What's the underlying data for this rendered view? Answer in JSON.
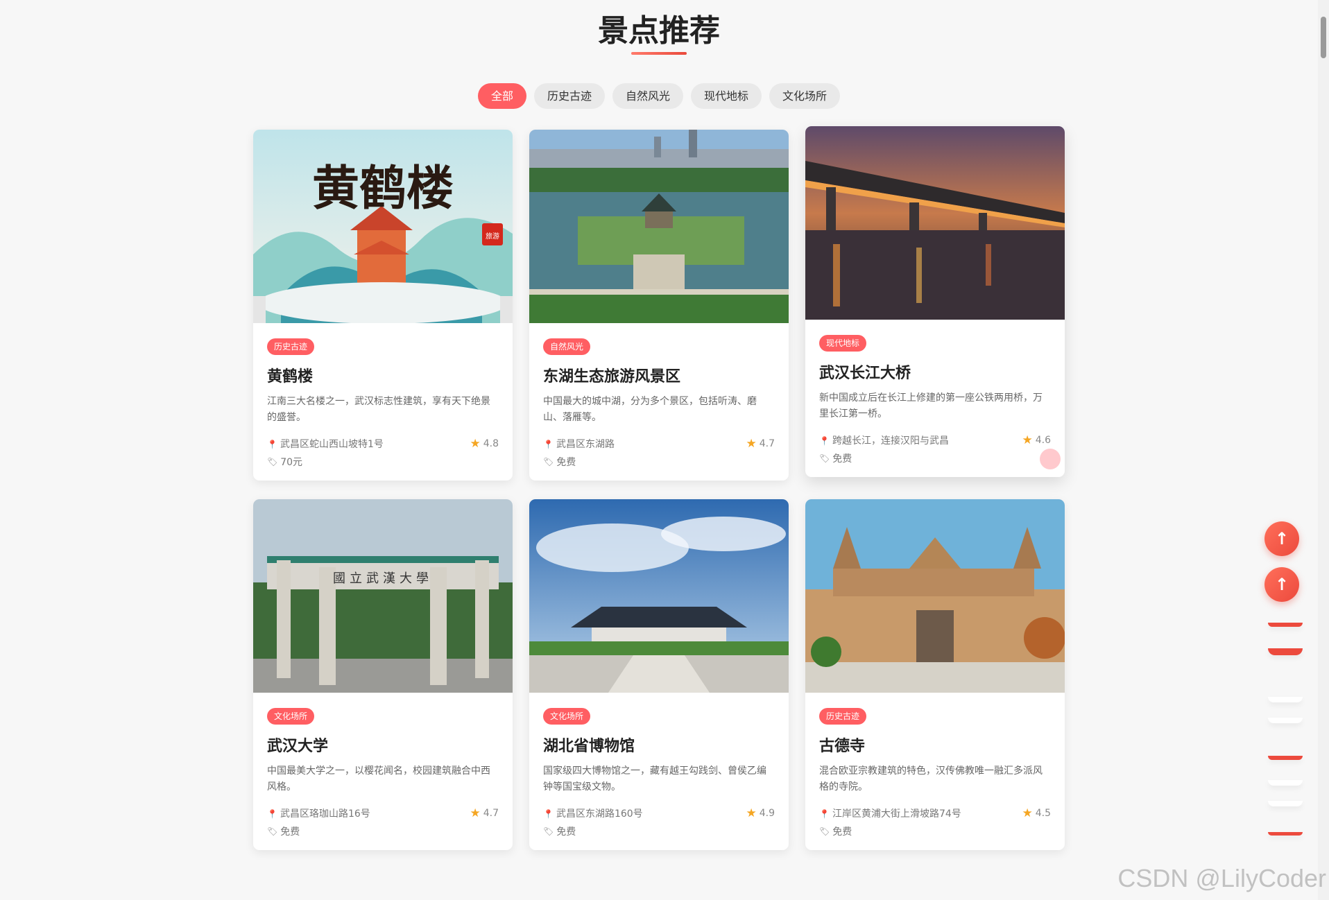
{
  "section_title": "景点推荐",
  "filters": [
    "全部",
    "历史古迹",
    "自然风光",
    "现代地标",
    "文化场所"
  ],
  "active_filter": "全部",
  "cards": [
    {
      "tag": "历史古迹",
      "name": "黄鹤楼",
      "desc": "江南三大名楼之一，武汉标志性建筑，享有天下绝景的盛誉。",
      "address": "武昌区蛇山西山坡特1号",
      "rating": "4.8",
      "price": "70元",
      "image_text": "黄鹤楼",
      "image_stamp": "旅游"
    },
    {
      "tag": "自然风光",
      "name": "东湖生态旅游风景区",
      "desc": "中国最大的城中湖，分为多个景区，包括听涛、磨山、落雁等。",
      "address": "武昌区东湖路",
      "rating": "4.7",
      "price": "免费"
    },
    {
      "tag": "现代地标",
      "name": "武汉长江大桥",
      "desc": "新中国成立后在长江上修建的第一座公铁两用桥，万里长江第一桥。",
      "address": "跨越长江，连接汉阳与武昌",
      "rating": "4.6",
      "price": "免费"
    },
    {
      "tag": "文化场所",
      "name": "武汉大学",
      "desc": "中国最美大学之一，以樱花闻名，校园建筑融合中西风格。",
      "address": "武昌区珞珈山路16号",
      "rating": "4.7",
      "price": "免费",
      "image_text": "國立武漢大學"
    },
    {
      "tag": "文化场所",
      "name": "湖北省博物馆",
      "desc": "国家级四大博物馆之一，藏有越王勾践剑、曾侯乙编钟等国宝级文物。",
      "address": "武昌区东湖路160号",
      "rating": "4.9",
      "price": "免费"
    },
    {
      "tag": "历史古迹",
      "name": "古德寺",
      "desc": "混合欧亚宗教建筑的特色，汉传佛教唯一融汇多派风格的寺院。",
      "address": "江岸区黄浦大街上滑坡路74号",
      "rating": "4.5",
      "price": "免费"
    }
  ],
  "icons": {
    "location": "map-pin-icon",
    "price": "price-tag-icon",
    "rating": "star-icon",
    "back_to_top": "arrow-up-icon"
  },
  "watermark": "CSDN @LilyCoder",
  "colors": {
    "accent": "#ff5e62",
    "fab": "#ec4a3d",
    "star": "#f5a623"
  }
}
